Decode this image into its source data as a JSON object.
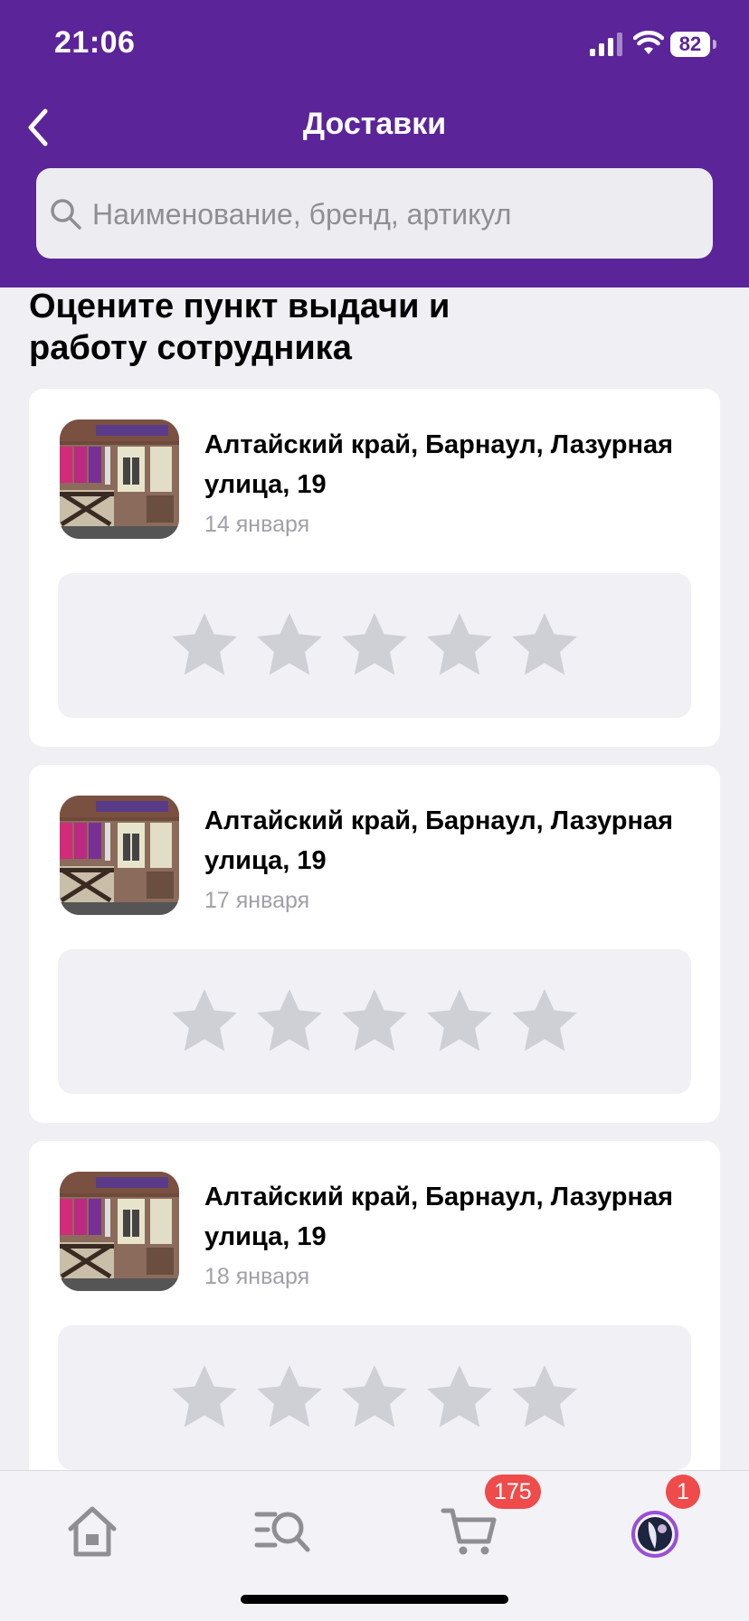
{
  "status_bar": {
    "time": "21:06",
    "battery": "82"
  },
  "header": {
    "title": "Доставки"
  },
  "search": {
    "placeholder": "Наименование, бренд, артикул"
  },
  "section_title": "Оцените пункт выдачи и работу сотрудника",
  "cards": [
    {
      "address": "Алтайский край, Барнаул, Лазурная улица, 19",
      "date": "14 января",
      "rating": 0,
      "max_rating": 5
    },
    {
      "address": "Алтайский край, Барнаул, Лазурная улица, 19",
      "date": "17 января",
      "rating": 0,
      "max_rating": 5
    },
    {
      "address": "Алтайский край, Барнаул, Лазурная улица, 19",
      "date": "18 января",
      "rating": 0,
      "max_rating": 5
    }
  ],
  "tabbar": {
    "cart_badge": "175",
    "profile_badge": "1"
  },
  "colors": {
    "brand": "#5b2499",
    "badge": "#ef4b4b",
    "star_inactive": "#cfcfd6"
  },
  "icons": [
    "chevron-left-icon",
    "search-icon",
    "star-icon",
    "home-icon",
    "catalog-search-icon",
    "cart-icon",
    "avatar"
  ]
}
